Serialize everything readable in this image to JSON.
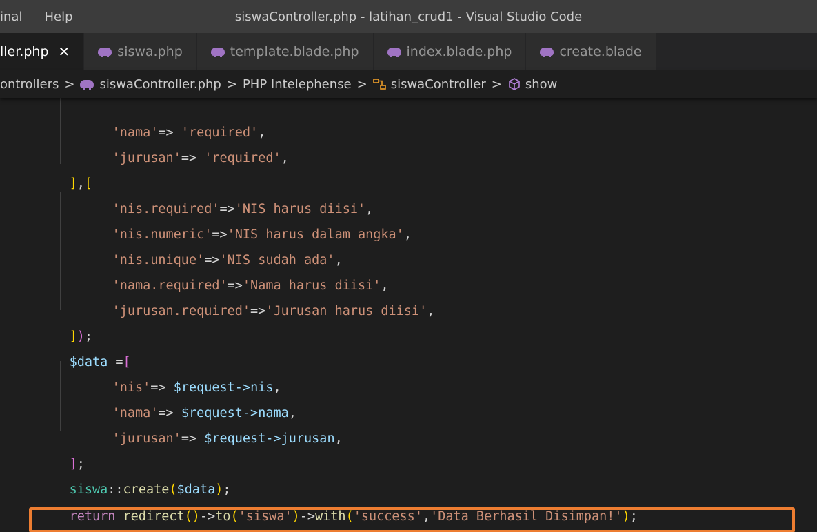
{
  "menu": [
    "inal",
    "Help"
  ],
  "window_title": "siswaController.php - latihan_crud1 - Visual Studio Code",
  "tabs": [
    {
      "label": "ller.php",
      "active": true,
      "close": "✕"
    },
    {
      "label": "siswa.php",
      "active": false
    },
    {
      "label": "template.blade.php",
      "active": false
    },
    {
      "label": "index.blade.php",
      "active": false
    },
    {
      "label": "create.blade",
      "active": false
    }
  ],
  "breadcrumb": {
    "folder": "ontrollers",
    "file": "siswaController.php",
    "ext": "PHP Intelephense",
    "class": "siswaController",
    "method": "show",
    "sep": ">"
  },
  "code": {
    "l1": {
      "key": "'nama'",
      "arrow": "=>",
      "val": "'required'",
      "end": ","
    },
    "l2": {
      "key": "'jurusan'",
      "arrow": "=>",
      "val": "'required'",
      "end": ","
    },
    "l3": {
      "a": "]",
      "b": ",",
      "c": "["
    },
    "l4": {
      "key": "'nis.required'",
      "arrow": "=>",
      "val": "'NIS harus diisi'",
      "end": ","
    },
    "l5": {
      "key": "'nis.numeric'",
      "arrow": "=>",
      "val": "'NIS harus dalam angka'",
      "end": ","
    },
    "l6": {
      "key": "'nis.unique'",
      "arrow": "=>",
      "val": "'NIS sudah ada'",
      "end": ","
    },
    "l7": {
      "key": "'nama.required'",
      "arrow": "=>",
      "val": "'Nama harus diisi'",
      "end": ","
    },
    "l8": {
      "key": "'jurusan.required'",
      "arrow": "=>",
      "val": "'Jurusan harus diisi'",
      "end": ","
    },
    "l9": {
      "a": "]",
      "b": ")",
      "c": ";"
    },
    "l10": {
      "var": "$data",
      "eq": " =",
      "b": "["
    },
    "l11": {
      "key": "'nis'",
      "arrow": "=> ",
      "var": "$request",
      "prop": "->nis",
      "end": ","
    },
    "l12": {
      "key": "'nama'",
      "arrow": "=> ",
      "var": "$request",
      "prop": "->nama",
      "end": ","
    },
    "l13": {
      "key": "'jurusan'",
      "arrow": "=> ",
      "var": "$request",
      "prop": "->jurusan",
      "end": ","
    },
    "l14": {
      "a": "]",
      "b": ";"
    },
    "l15": {
      "cls": "siswa",
      "op": "::",
      "fn": "create",
      "p1": "(",
      "var": "$data",
      "p2": ")",
      "end": ";"
    },
    "l16": {
      "kw": "return",
      "fn1": "redirect",
      "p1": "()",
      "arrow1": "->",
      "fn2": "to",
      "p2": "(",
      "s1": "'siswa'",
      "p3": ")",
      "arrow2": "->",
      "fn3": "with",
      "p4": "(",
      "s2": "'success'",
      "comma": ",",
      "s3": "'Data Berhasil Disimpan!'",
      "p5": ")",
      "end": ";"
    }
  },
  "colors": {
    "highlight": "#ed7d31",
    "php_icon": "#a074c4"
  }
}
